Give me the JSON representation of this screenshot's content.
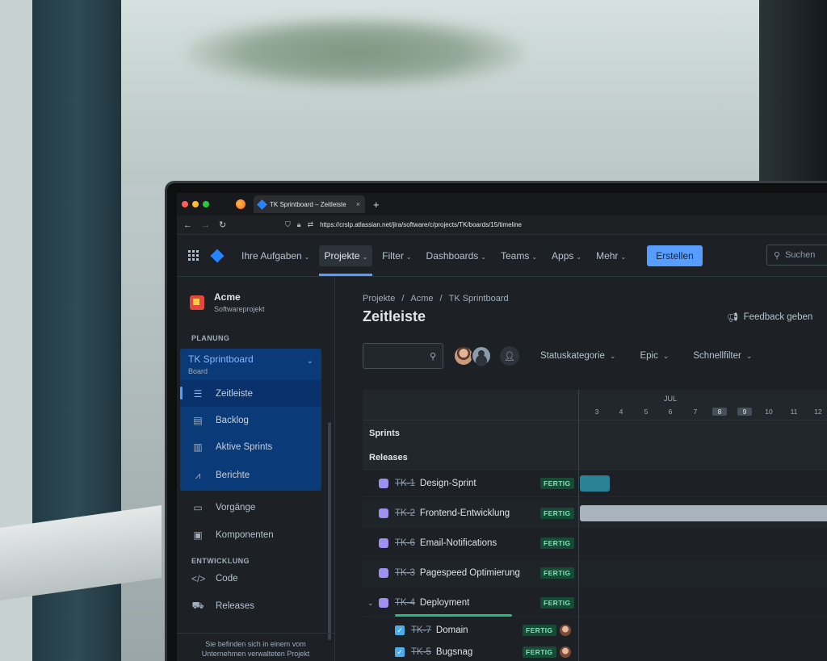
{
  "browser": {
    "tab_title": "TK Sprintboard – Zeitleiste – Jira",
    "tab_close": "×",
    "new_tab": "+",
    "url": "https://crslp.atlassian.net/jira/software/c/projects/TK/boards/15/timeline"
  },
  "topnav": {
    "items": [
      "Ihre Aufgaben",
      "Projekte",
      "Filter",
      "Dashboards",
      "Teams",
      "Apps",
      "Mehr"
    ],
    "active": "Projekte",
    "create_label": "Erstellen",
    "search_placeholder": "Suchen"
  },
  "sidebar": {
    "project_name": "Acme",
    "project_type": "Softwareprojekt",
    "section_planning": "PLANUNG",
    "board_name": "TK Sprintboard",
    "board_sub": "Board",
    "planning_items": [
      "Zeitleiste",
      "Backlog",
      "Aktive Sprints",
      "Berichte"
    ],
    "other_items": [
      "Vorgänge",
      "Komponenten"
    ],
    "section_dev": "ENTWICKLUNG",
    "dev_items": [
      "Code",
      "Releases"
    ],
    "footer": "Sie befinden sich in einem vom Unternehmen verwalteten Projekt"
  },
  "main": {
    "breadcrumb": [
      "Projekte",
      "Acme",
      "TK Sprintboard"
    ],
    "breadcrumb_sep": "/",
    "title": "Zeitleiste",
    "feedback_label": "Feedback geben",
    "filters": [
      "Statuskategorie",
      "Epic",
      "Schnellfilter"
    ]
  },
  "timeline": {
    "month": "JUL",
    "days": [
      "3",
      "4",
      "5",
      "6",
      "7",
      "8",
      "9",
      "10",
      "11",
      "12"
    ],
    "weekend_days": [
      "8",
      "9"
    ],
    "groups": [
      "Sprints",
      "Releases"
    ],
    "status_done": "FERTIG",
    "epics": [
      {
        "key": "TK-1",
        "name": "Design-Sprint",
        "status": "FERTIG"
      },
      {
        "key": "TK-2",
        "name": "Frontend-Entwicklung",
        "status": "FERTIG"
      },
      {
        "key": "TK-6",
        "name": "Email-Notifications",
        "status": "FERTIG"
      },
      {
        "key": "TK-3",
        "name": "Pagespeed Optimierung",
        "status": "FERTIG"
      },
      {
        "key": "TK-4",
        "name": "Deployment",
        "status": "FERTIG"
      }
    ],
    "children": [
      {
        "key": "TK-7",
        "name": "Domain",
        "status": "FERTIG"
      },
      {
        "key": "TK-5",
        "name": "Bugsnag",
        "status": "FERTIG"
      }
    ],
    "bar_colors": {
      "design": "#2a8296",
      "frontend": "#a8b3bd"
    }
  }
}
